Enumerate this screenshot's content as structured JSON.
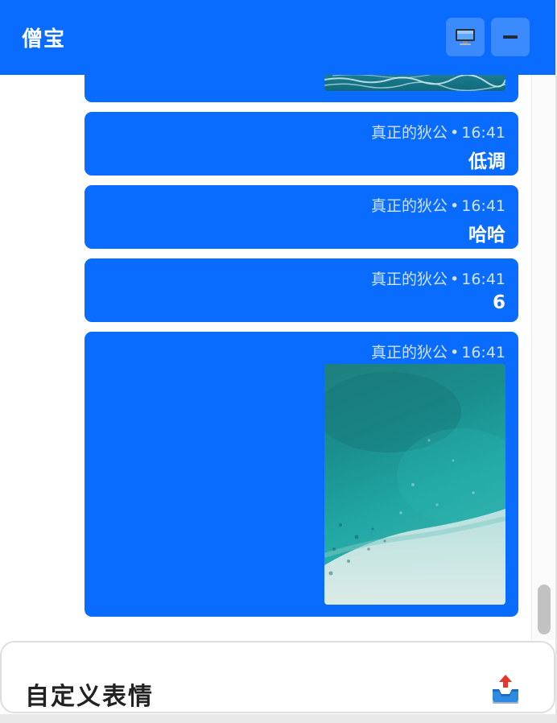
{
  "header": {
    "title": "僧宝",
    "monitor_icon": "monitor-icon",
    "minimize_icon": "minimize-icon"
  },
  "messages": [
    {
      "type": "image",
      "sender": "",
      "time": ""
    },
    {
      "type": "text",
      "sender": "真正的狄公",
      "time": "16:41",
      "text": "低调"
    },
    {
      "type": "text",
      "sender": "真正的狄公",
      "time": "16:41",
      "text": "哈哈"
    },
    {
      "type": "text",
      "sender": "真正的狄公",
      "time": "16:41",
      "text": "6"
    },
    {
      "type": "image",
      "sender": "真正的狄公",
      "time": "16:41"
    }
  ],
  "separator": "•",
  "composer": {
    "label": "自定义表情",
    "upload_icon": "upload-tray-icon"
  },
  "colors": {
    "accent": "#0a6cff",
    "meta_text": "#cfe2ff"
  }
}
